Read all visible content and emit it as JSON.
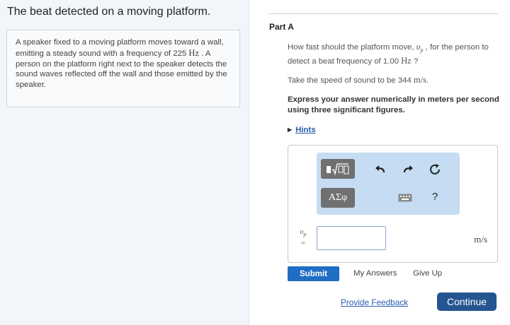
{
  "problem": {
    "title": "The beat detected on a moving platform.",
    "text_1": "A speaker fixed to a moving platform moves toward a wall, emitting a steady sound with a frequency of 225 ",
    "unit_hz": "Hz",
    "text_2": " . A person on the platform right next to the speaker detects the sound waves reflected off the wall and those emitted by the speaker."
  },
  "part": {
    "label": "Part A",
    "question_1": "How fast should the platform move, ",
    "var_symbol": "υ",
    "var_sub": "p",
    "question_2": " , for the person to detect a beat frequency of 1.00 ",
    "question_unit": "Hz",
    "question_3": " ?",
    "speed_1": "Take the speed of sound to be 344 ",
    "speed_unit": "m/s",
    "speed_2": ".",
    "instruction": "Express your answer numerically in meters per second using three significant figures.",
    "hints_label": "Hints"
  },
  "answer": {
    "templates_icon": "templates-radical-icon",
    "greek_label": "ΑΣφ",
    "undo_icon": "undo-icon",
    "redo_icon": "redo-icon",
    "reset_icon": "reset-icon",
    "keyboard_icon": "keyboard-icon",
    "help_label": "?",
    "var_symbol": "υ",
    "var_sub": "p",
    "equals": "=",
    "input_value": "",
    "unit": "m/s"
  },
  "actions": {
    "submit": "Submit",
    "my_answers": "My Answers",
    "give_up": "Give Up",
    "feedback": "Provide Feedback",
    "continue": "Continue"
  },
  "colors": {
    "submit_bg": "#1f6dc4",
    "continue_bg": "#245591",
    "toolbar_bg": "#c5dcf3",
    "link": "#2a5db0"
  }
}
